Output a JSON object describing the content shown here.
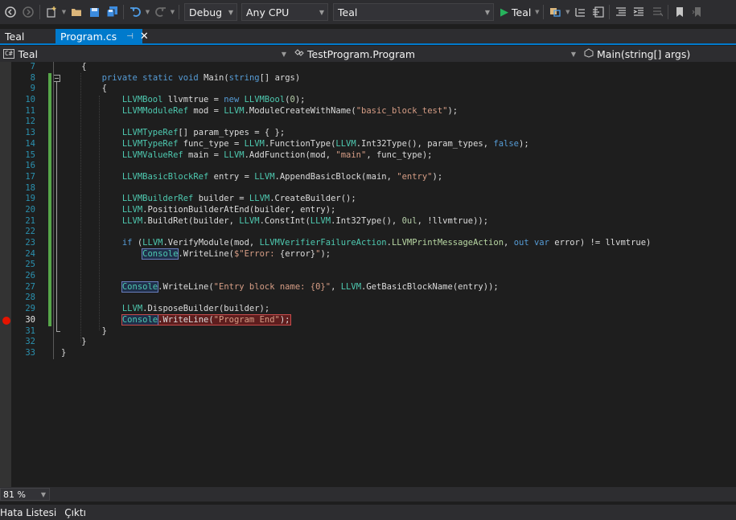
{
  "toolbar": {
    "configuration": "Debug",
    "platform": "Any CPU",
    "startup_project": "Teal",
    "start_label": "Teal"
  },
  "tabs": {
    "inactive_label": "Teal",
    "active_label": "Program.cs"
  },
  "navbar": {
    "project": "Teal",
    "type": "TestProgram.Program",
    "member": "Main(string[] args)"
  },
  "editor": {
    "line_numbers": [
      "7",
      "8",
      "9",
      "10",
      "11",
      "12",
      "13",
      "14",
      "15",
      "16",
      "17",
      "18",
      "19",
      "20",
      "21",
      "22",
      "23",
      "24",
      "25",
      "26",
      "27",
      "28",
      "29",
      "30",
      "31",
      "32",
      "33"
    ],
    "current_line": "30",
    "code": {
      "l7_brace": "{",
      "l8_kw1": "private",
      "l8_kw2": "static",
      "l8_kw3": "void",
      "l8_name": "Main(",
      "l8_kw4": "string",
      "l8_rest": "[] args)",
      "l9_brace": "{",
      "l10_t1": "LLVMBool",
      "l10_a": " llvmtrue = ",
      "l10_kw": "new",
      "l10_t2": " LLVMBool",
      "l10_b": "(",
      "l10_n": "0",
      "l10_c": ");",
      "l11_t1": "LLVMModuleRef",
      "l11_a": " mod = ",
      "l11_t2": "LLVM",
      "l11_b": ".ModuleCreateWithName(",
      "l11_s": "\"basic_block_test\"",
      "l11_c": ");",
      "l13_t1": "LLVMTypeRef",
      "l13_a": "[] param_types = { };",
      "l14_t1": "LLVMTypeRef",
      "l14_a": " func_type = ",
      "l14_t2": "LLVM",
      "l14_b": ".FunctionType(",
      "l14_t3": "LLVM",
      "l14_c": ".Int32Type(), param_types, ",
      "l14_kw": "false",
      "l14_d": ");",
      "l15_t1": "LLVMValueRef",
      "l15_a": " main = ",
      "l15_t2": "LLVM",
      "l15_b": ".AddFunction(mod, ",
      "l15_s": "\"main\"",
      "l15_c": ", func_type);",
      "l17_t1": "LLVMBasicBlockRef",
      "l17_a": " entry = ",
      "l17_t2": "LLVM",
      "l17_b": ".AppendBasicBlock(main, ",
      "l17_s": "\"entry\"",
      "l17_c": ");",
      "l19_t1": "LLVMBuilderRef",
      "l19_a": " builder = ",
      "l19_t2": "LLVM",
      "l19_b": ".CreateBuilder();",
      "l20_t1": "LLVM",
      "l20_a": ".PositionBuilderAtEnd(builder, entry);",
      "l21_t1": "LLVM",
      "l21_a": ".BuildRet(builder, ",
      "l21_t2": "LLVM",
      "l21_b": ".ConstInt(",
      "l21_t3": "LLVM",
      "l21_c": ".Int32Type(), ",
      "l21_n": "0ul",
      "l21_d": ", !llvmtrue));",
      "l23_kw1": "if",
      "l23_a": " (",
      "l23_t1": "LLVM",
      "l23_b": ".VerifyModule(mod, ",
      "l23_t2": "LLVMVerifierFailureAction",
      "l23_c": ".",
      "l23_e": "LLVMPrintMessageAction",
      "l23_d": ", ",
      "l23_kw2": "out",
      "l23_kw3": " var",
      "l23_f": " error) != llvmtrue)",
      "l24_t1": "Console",
      "l24_a": ".WriteLine(",
      "l24_s": "$\"Error: ",
      "l24_i": "{error}",
      "l24_s2": "\"",
      "l24_b": ");",
      "l27_t1": "Console",
      "l27_a": ".WriteLine(",
      "l27_s": "\"Entry block name: {0}\"",
      "l27_b": ", ",
      "l27_t2": "LLVM",
      "l27_c": ".GetBasicBlockName(entry));",
      "l29_t1": "LLVM",
      "l29_a": ".DisposeBuilder(builder);",
      "l30_t1": "Console",
      "l30_a": ".WriteLine(",
      "l30_s": "\"Program End\"",
      "l30_b": ");",
      "l31_brace": "}",
      "l32_brace": "}",
      "l33_brace": "}"
    }
  },
  "status": {
    "zoom": "81 %"
  },
  "bottom_tabs": {
    "error_list": "Hata Listesi",
    "output": "Çıktı"
  },
  "colors": {
    "accent": "#007acc",
    "breakpoint": "#e51400",
    "keyword": "#569cd6",
    "type": "#4ec9b0",
    "string": "#d69d85"
  }
}
